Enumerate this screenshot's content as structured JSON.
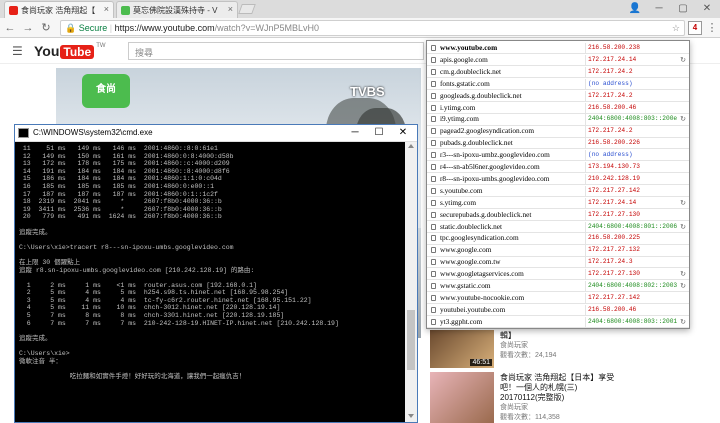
{
  "browser": {
    "tabs": [
      {
        "title": "食尚玩家 浩角翔起【",
        "favicon_color": "#e62117",
        "active": true
      },
      {
        "title": "莫忘佛院設漢殊持寺 - V",
        "favicon_color": "#4cbc4e",
        "active": false
      }
    ],
    "address": {
      "secure_label": "Secure",
      "host": "https://www.youtube.com",
      "path": "/watch?v=WJnP5MBLvH0"
    },
    "extension_badge": "4"
  },
  "youtube": {
    "logo_you": "You",
    "logo_tube": "Tube",
    "region": "TW",
    "search_placeholder": "搜尋",
    "video": {
      "channel_logo": "食尚",
      "broadcaster": "TVBS"
    },
    "recommendations": [
      {
        "title": "輯】",
        "channel": "食尚玩家",
        "views": "觀看次數：24,194",
        "duration": "46:51"
      },
      {
        "title_lines": [
          "食尚玩家 浩角翔起【日本】享受",
          "吧！一個人的札幌(三)",
          "20170112(完整版)"
        ],
        "channel": "食尚玩家",
        "views": "觀看次數：114,358"
      }
    ]
  },
  "cmd": {
    "title": "C:\\WINDOWS\\system32\\cmd.exe",
    "lines": [
      " 11    51 ms   149 ms   146 ms  2001:4860::8:0:61e1",
      " 12   149 ms   150 ms   161 ms  2001:4860:0:8:4000:d58b",
      " 13   172 ms   178 ms   175 ms  2001:4860::c:4000:d209",
      " 14   191 ms   184 ms   184 ms  2001:4860::8:4000:d8f6",
      " 15   186 ms   184 ms   184 ms  2001:4860:1:1:0:c04d",
      " 16   185 ms   185 ms   185 ms  2001:4860:0:e00::1",
      " 17   187 ms   187 ms   187 ms  2001:4860:0:1::1c2f",
      " 18  2319 ms  2041 ms     *     2607:f8b0:4000:36::b",
      " 19  3411 ms  2536 ms     *     2607:f8b0:4000:36::b",
      " 20   779 ms   491 ms  1624 ms  2607:f8b0:4000:36::b",
      "",
      "追蹤完成。",
      "",
      "C:\\Users\\xie>tracert r8---sn-ipoxu-umbs.googlevideo.com",
      "",
      "在上限 30 個躍點上",
      "追蹤 r8.sn-ipoxu-umbs.googlevideo.com [210.242.128.19] 的路由:",
      "",
      "  1     2 ms     1 ms    <1 ms  router.asus.com [192.168.0.1]",
      "  2     5 ms     4 ms     5 ms  h254.s98.ts.hinet.net [168.95.98.254]",
      "  3     5 ms     4 ms     4 ms  tc-fy-c6r2.router.hinet.net [168.95.151.22]",
      "  4     5 ms    11 ms    10 ms  chch-3012.hinet.net [220.128.19.14]",
      "  5     7 ms     8 ms     8 ms  chch-3301.hinet.net [220.128.19.185]",
      "  6     7 ms     7 ms     7 ms  210-242-128-19.HINET-IP.hinet.net [210.242.128.19]",
      "",
      "追蹤完成。",
      "",
      "C:\\Users\\xie>",
      "微軟注音 半：",
      "",
      "             吃拉麵和如實件手燈！好好玩的北海道，讓我們一起瘋仇吉！"
    ]
  },
  "ipvfoo": {
    "colors": {
      "v4": "#c40000",
      "v6": "#1a8a1a",
      "none": "#2a4fd0"
    },
    "rows": [
      {
        "domain": "www.youtube.com",
        "ip": "216.58.200.238",
        "ver": "v4",
        "bold": true,
        "flag": ""
      },
      {
        "domain": "apis.google.com",
        "ip": "172.217.24.14",
        "ver": "v4",
        "bold": false,
        "flag": "↻"
      },
      {
        "domain": "cm.g.doubleclick.net",
        "ip": "172.217.24.2",
        "ver": "v4",
        "bold": false,
        "flag": ""
      },
      {
        "domain": "fonts.gstatic.com",
        "ip": "(no address)",
        "ver": "none",
        "bold": false,
        "flag": ""
      },
      {
        "domain": "googleads.g.doubleclick.net",
        "ip": "172.217.24.2",
        "ver": "v4",
        "bold": false,
        "flag": ""
      },
      {
        "domain": "i.ytimg.com",
        "ip": "216.58.200.46",
        "ver": "v4",
        "bold": false,
        "flag": ""
      },
      {
        "domain": "i9.ytimg.com",
        "ip": "2404:6800:4008:803::200e",
        "ver": "v6",
        "bold": false,
        "flag": "↻"
      },
      {
        "domain": "pagead2.googlesyndication.com",
        "ip": "172.217.24.2",
        "ver": "v4",
        "bold": false,
        "flag": ""
      },
      {
        "domain": "pubads.g.doubleclick.net",
        "ip": "216.58.200.226",
        "ver": "v4",
        "bold": false,
        "flag": ""
      },
      {
        "domain": "r3---sn-ipoxu-umbz.googlevideo.com",
        "ip": "(no address)",
        "ver": "none",
        "bold": false,
        "flag": ""
      },
      {
        "domain": "r4---sn-ab5l6ner.googlevideo.com",
        "ip": "173.194.130.73",
        "ver": "v4",
        "bold": false,
        "flag": ""
      },
      {
        "domain": "r8---sn-ipoxu-umbs.googlevideo.com",
        "ip": "210.242.128.19",
        "ver": "v4",
        "bold": false,
        "flag": ""
      },
      {
        "domain": "s.youtube.com",
        "ip": "172.217.27.142",
        "ver": "v4",
        "bold": false,
        "flag": ""
      },
      {
        "domain": "s.ytimg.com",
        "ip": "172.217.24.14",
        "ver": "v4",
        "bold": false,
        "flag": "↻"
      },
      {
        "domain": "securepubads.g.doubleclick.net",
        "ip": "172.217.27.130",
        "ver": "v4",
        "bold": false,
        "flag": ""
      },
      {
        "domain": "static.doubleclick.net",
        "ip": "2404:6800:4008:801::2006",
        "ver": "v6",
        "bold": false,
        "flag": "↻"
      },
      {
        "domain": "tpc.googlesyndication.com",
        "ip": "216.58.200.225",
        "ver": "v4",
        "bold": false,
        "flag": ""
      },
      {
        "domain": "www.google.com",
        "ip": "172.217.27.132",
        "ver": "v4",
        "bold": false,
        "flag": ""
      },
      {
        "domain": "www.google.com.tw",
        "ip": "172.217.24.3",
        "ver": "v4",
        "bold": false,
        "flag": ""
      },
      {
        "domain": "www.googletagservices.com",
        "ip": "172.217.27.130",
        "ver": "v4",
        "bold": false,
        "flag": "↻"
      },
      {
        "domain": "www.gstatic.com",
        "ip": "2404:6800:4008:802::2003",
        "ver": "v6",
        "bold": false,
        "flag": "↻"
      },
      {
        "domain": "www.youtube-nocookie.com",
        "ip": "172.217.27.142",
        "ver": "v4",
        "bold": false,
        "flag": ""
      },
      {
        "domain": "youtubei.youtube.com",
        "ip": "216.58.200.46",
        "ver": "v4",
        "bold": false,
        "flag": ""
      },
      {
        "domain": "yt3.ggpht.com",
        "ip": "2404:6800:4008:803::2001",
        "ver": "v6",
        "bold": false,
        "flag": "↻"
      }
    ]
  }
}
